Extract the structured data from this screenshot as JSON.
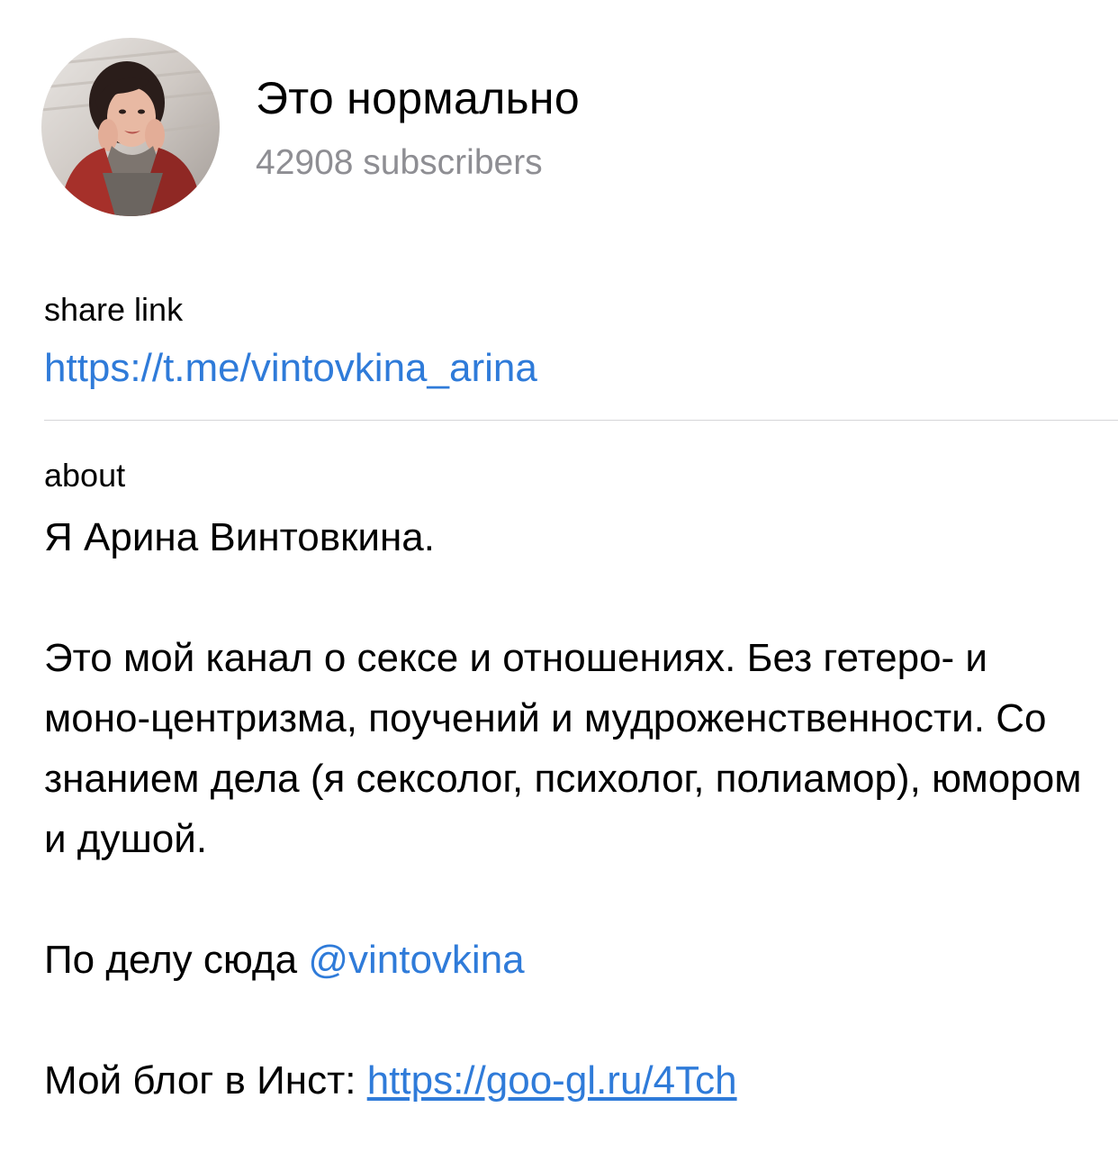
{
  "channel": {
    "title": "Это нормально",
    "subscribers": "42908 subscribers"
  },
  "share": {
    "label": "share link",
    "link": "https://t.me/vintovkina_arina"
  },
  "about": {
    "label": "about",
    "intro": "Я Арина Винтовкина.",
    "description": "Это мой канал о сексе и отношениях. Без гетеро- и моно-центризма, поучений и мудроженственности. Со знанием дела (я сексолог, психолог, полиамор), юмором и душой.",
    "contact_prefix": "По делу сюда ",
    "contact_mention": "@vintovkina",
    "blog_prefix": "Мой блог в Инст: ",
    "blog_link": "https://goo-gl.ru/4Tch"
  },
  "colors": {
    "link": "#2f7bd9",
    "secondary_text": "#8e8e93",
    "divider": "#d6d6d8"
  },
  "icons": {
    "avatar": "channel-avatar-photo"
  }
}
